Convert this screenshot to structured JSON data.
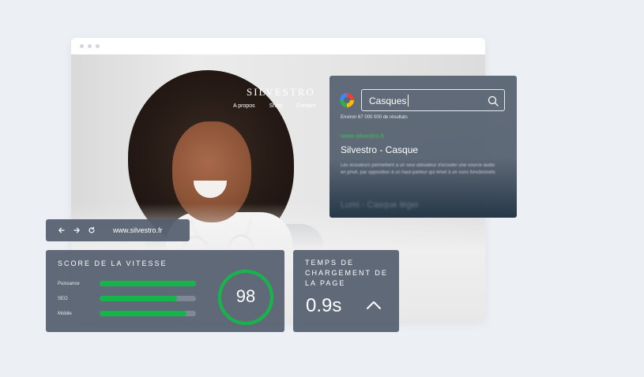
{
  "site": {
    "brand": "SILVESTRO",
    "nav": [
      "A propos",
      "Shop",
      "Contact"
    ]
  },
  "search": {
    "query": "Casques",
    "result_count": "Environ 67 000 000 de résultats",
    "result_url": "www.silvestro.fr",
    "result_title": "Silvestro - Casque",
    "result_desc": "Les écouteurs permettent à un seul utilisateur d'écouter une source audio en privé, par opposition à un haut-parleur qui émet à un sons fonctionnels",
    "second_result": "Lumi - Casque léger"
  },
  "address_bar": {
    "url": "www.silvestro.fr"
  },
  "speed": {
    "title": "SCORE DE LA VITESSE",
    "metrics": [
      {
        "label": "Puissance",
        "value": 1.0
      },
      {
        "label": "SEO",
        "value": 0.8
      },
      {
        "label": "Mobile",
        "value": 0.9
      }
    ],
    "score": "98",
    "score_fraction": 0.98,
    "accent": "#14b64a"
  },
  "load": {
    "title": "TEMPS DE CHARGEMENT DE LA PAGE",
    "value": "0.9s"
  }
}
